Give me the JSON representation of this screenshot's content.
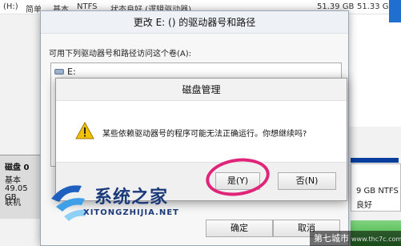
{
  "background": {
    "volume_row": {
      "drive": "(H:)",
      "layout": "简单",
      "type": "基本",
      "filesystem": "NTFS",
      "status": "状态良好 (逻辑驱动器)",
      "capacity": "51.39 GB",
      "free": "51.33 GB"
    },
    "disk_panel": {
      "name": "磁盘 0",
      "type": "基本",
      "size": "49.05 GB",
      "status": "联机"
    },
    "partition_panel": {
      "size": "9 GB NTFS",
      "status": "良好"
    }
  },
  "change_dialog": {
    "title": "更改 E: () 的驱动器号和路径",
    "prompt": "可用下列驱动器号和路径访问这个卷(A):",
    "drives": [
      "E:"
    ],
    "ok_label": "确定",
    "cancel_label": "取消"
  },
  "message_box": {
    "title": "磁盘管理",
    "message": "某些依赖驱动器号的程序可能无法正确运行。你想继续吗?",
    "yes_label": "是(Y)",
    "no_label": "否(N)"
  },
  "watermarks": {
    "logo_cn": "系统之家",
    "logo_en": "XITONGZHIJIA.NET",
    "site_cn": "第七城市",
    "site_url": "www.thc7c.com"
  },
  "colors": {
    "highlight_circle": "#e0247a",
    "partition_stripe": "#0a3e9c",
    "warning_icon": "#f2c200"
  },
  "icons": {
    "warning": "warning-triangle-icon",
    "drive": "drive-icon"
  }
}
